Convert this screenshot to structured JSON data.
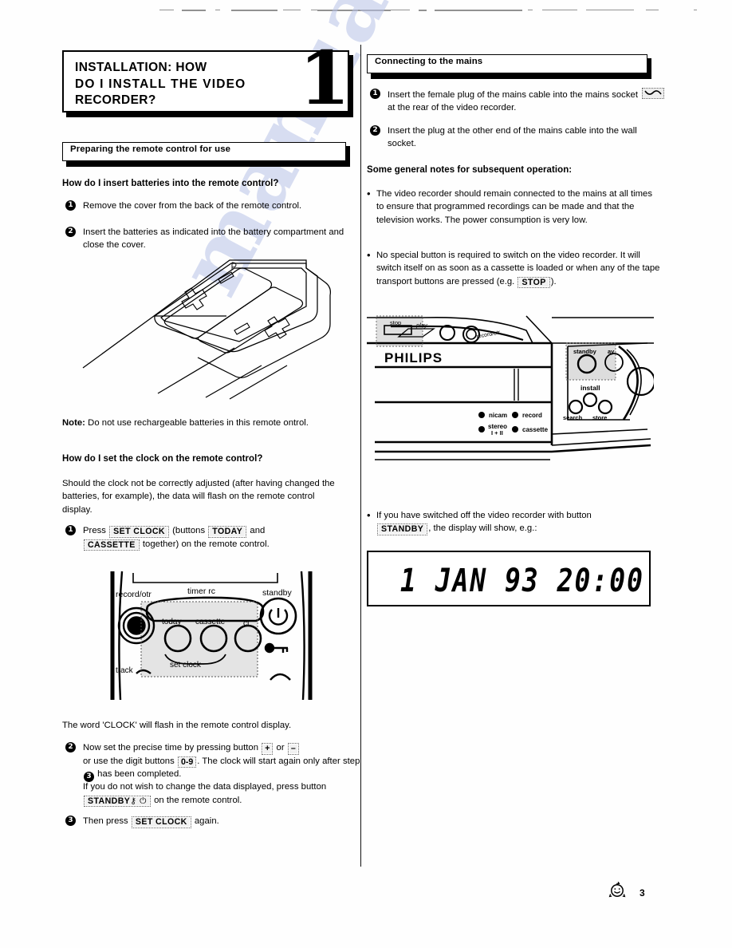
{
  "document": {
    "page_number": "3",
    "watermark": "manualslive.com"
  },
  "chapter": {
    "number": "1",
    "title_line1": "INSTALLATION:  HOW",
    "title_line2": "DO  I  INSTALL  THE  VIDEO",
    "title_line3": "RECORDER?"
  },
  "left_column": {
    "section_title": "Preparing the remote control for use",
    "heading_batteries": "How do I insert batteries into the remote control?",
    "step1": "Remove the cover from the back of the remote control.",
    "step2": "Insert the batteries as indicated into the battery compartment and close the cover.",
    "battery_figure": {
      "name": "remote-battery-compartment",
      "plus_label": "+",
      "minus_label": "−"
    },
    "note_label": "Note:",
    "note_text": "Do not use rechargeable batteries in this remote ontrol.",
    "heading_clock": "How do I set the clock on the remote control?",
    "clock_intro": "Should the clock not be correctly adjusted (after having changed the batteries, for example), the data will flash on the remote control display.",
    "clock_step1_pre": "Press",
    "clock_step1_key1": "SET  CLOCK",
    "clock_step1_mid": "(buttons",
    "clock_step1_key2": "TODAY",
    "clock_step1_and": "and",
    "clock_step1_key3": "CASSETTE",
    "clock_step1_post": "together) on the remote control.",
    "remote_figure": {
      "name": "remote-control-set-clock",
      "label_record_otr": "record/otr",
      "label_timer_rc": "timer rc",
      "label_standby": "standby",
      "label_today": "today",
      "label_cassette": "cassette",
      "label_select": "ct",
      "label_set_clock": "set clock",
      "label_track": "track"
    },
    "clock_flash": "The word 'CLOCK' will flash in the remote control display.",
    "clock_step2_a": "Now set the precise time by pressing button",
    "clock_step2_key_plus": "+",
    "clock_step2_or": "or",
    "clock_step2_key_minus": "–",
    "clock_step2_b": "or use the digit buttons",
    "clock_step2_key_digits": "0-9",
    "clock_step2_c": ". The clock will start again only after step",
    "clock_step2_d": "has been completed.",
    "clock_step2_e": "If you do not wish to change the data displayed, press button",
    "clock_step2_key_standby": "STANDBY",
    "clock_step2_f": "on the remote control.",
    "clock_step3_pre": "Then press",
    "clock_step3_key": "SET  CLOCK",
    "clock_step3_post": "again."
  },
  "right_column": {
    "section_title": "Connecting to the mains",
    "step1_a": "Insert the female plug of the mains cable into the mains socket",
    "step1_b": "at the rear of the video recorder.",
    "step2": "Insert the plug at the other end of the mains cable into the wall socket.",
    "notes_heading": "Some general notes for subsequent operation:",
    "note1": "The video recorder should remain connected to the mains at all times to ensure that programmed recordings can be made and that the television works. The power consumption is very low.",
    "note2_a": "No special button is required to switch on the video recorder. It will switch itself on as soon as a cassette is loaded or when any of the tape transport buttons are pressed (e.g.",
    "note2_key": "STOP",
    "note2_b": ").",
    "vcr_figure": {
      "name": "vcr-front-panel",
      "brand": "PHILIPS",
      "btn_stop": "stop",
      "btn_play": "play",
      "btn_record_otr": "record/otr",
      "led_nicam": "nicam",
      "led_record": "record",
      "led_stereo": "stereo I + II",
      "led_cassette": "cassette",
      "btn_standby": "standby",
      "btn_display": "ay",
      "btn_install": "install",
      "btn_search": "search",
      "btn_store": "store"
    },
    "note3_a": "If you have switched off the video recorder with button",
    "note3_key": "STANDBY",
    "note3_b": ", the display will show, e.g.:",
    "lcd_display": "1 JAN   93  20:00"
  }
}
